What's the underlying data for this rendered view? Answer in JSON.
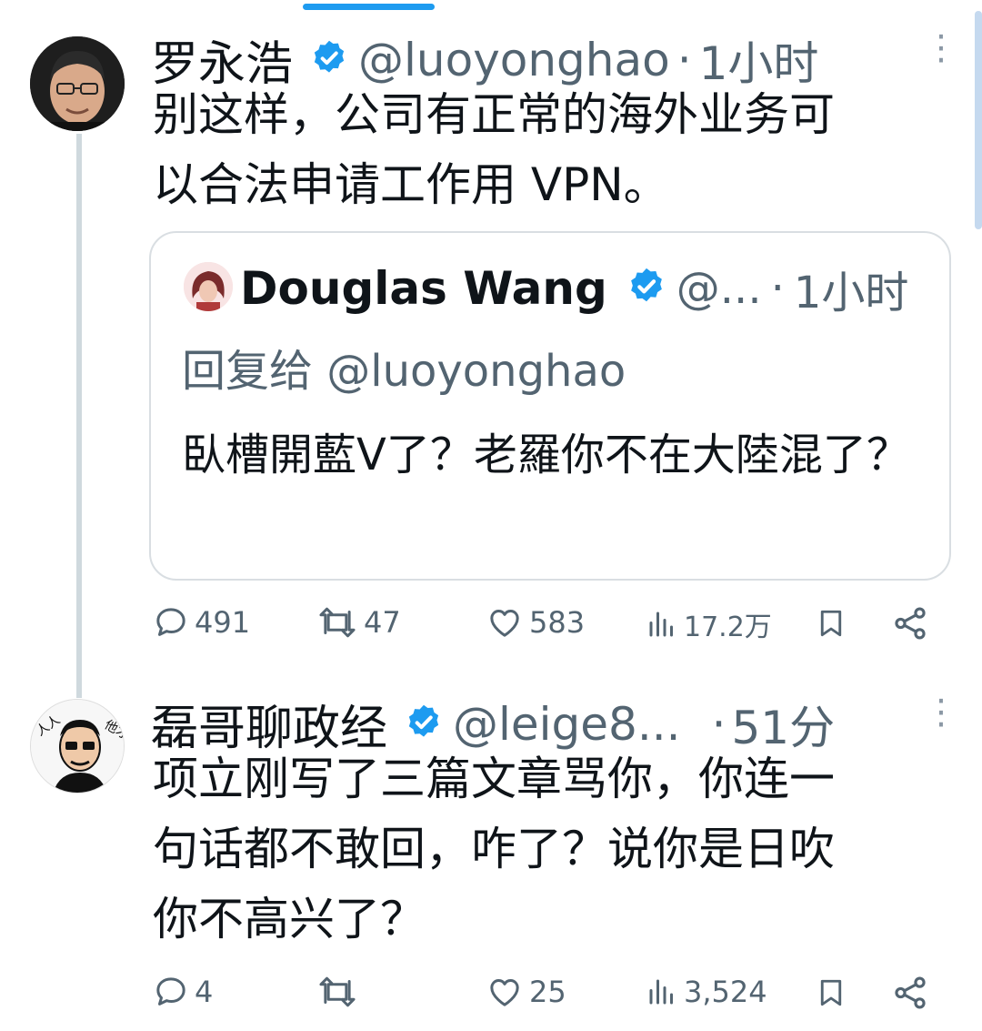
{
  "tweet1": {
    "name": "罗永浩",
    "handle": "@luoyonghao",
    "separator": "·",
    "time": "1小时",
    "text": "别这样，公司有正常的海外业务可\n以合法申请工作用 VPN。",
    "quote": {
      "name": "Douglas Wang",
      "handle": "@...",
      "separator": "·",
      "time": "1小时",
      "reply_to": "回复给 @luoyonghao",
      "text": "臥槽開藍V了？老羅你不在大陸混了？"
    },
    "actions": {
      "replies": "491",
      "retweets": "47",
      "likes": "583",
      "views": "17.2万"
    }
  },
  "tweet2": {
    "name": "磊哥聊政经",
    "handle": "@leige8...",
    "separator": "·",
    "time": "51分",
    "text": "项立刚写了三篇文章骂你，你连一\n句话都不敢回，咋了？说你是日吹\n你不高兴了？",
    "actions": {
      "replies": "4",
      "retweets": "",
      "likes": "25",
      "views": "3,524"
    }
  },
  "colors": {
    "accent": "#1d9bf0",
    "muted": "#536471",
    "text": "#0f1419",
    "border": "#cfd9de"
  },
  "icons": [
    "verified-badge-icon",
    "more-icon",
    "reply-icon",
    "retweet-icon",
    "like-icon",
    "views-icon",
    "bookmark-icon",
    "share-icon"
  ]
}
